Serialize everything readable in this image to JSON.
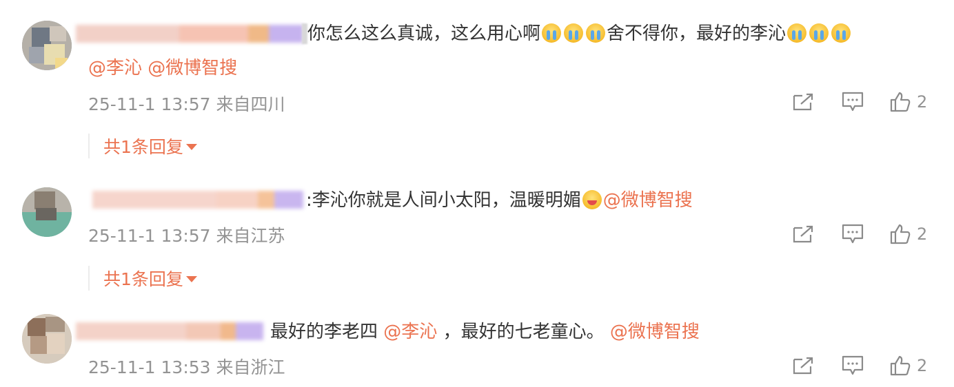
{
  "comments": [
    {
      "text_main": "你怎么这么真诚，这么用心啊",
      "text_mid": "舍不得你，最好的李沁",
      "mentions": [
        "@李沁",
        "@微博智搜"
      ],
      "time": "25-11-1 13:57",
      "location": "来自四川",
      "likes": "2",
      "replies_label": "共1条回复"
    },
    {
      "text_main": ":李沁你就是人间小太阳，温暖明媚",
      "mention": "@微博智搜",
      "time": "25-11-1 13:57",
      "location": "来自江苏",
      "likes": "2",
      "replies_label": "共1条回复"
    },
    {
      "text_a": "最好的李老四",
      "mention_a": "@李沁",
      "text_b": "，最好的七老童心。",
      "mention_b": "@微博智搜",
      "time": "25-11-1 13:53",
      "location": "来自浙江",
      "likes": "2"
    }
  ],
  "colors": {
    "link": "#eb7350",
    "meta": "#939393",
    "text": "#333333"
  },
  "icons": {
    "repost": "repost-icon",
    "comment": "comment-icon",
    "like": "like-icon",
    "emoji_cry": "crying-emoji",
    "emoji_blush": "blush-emoji"
  }
}
